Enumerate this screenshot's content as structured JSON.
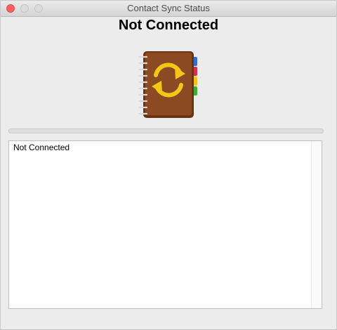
{
  "window": {
    "title": "Contact Sync Status"
  },
  "status": {
    "heading": "Not Connected",
    "progress": 0
  },
  "icon": {
    "name": "address-book-sync-icon"
  },
  "log": {
    "text": "Not Connected"
  },
  "colors": {
    "book_cover": "#8B4A22",
    "sync_arrows": "#F5C518",
    "close_button": "#FC605C"
  }
}
